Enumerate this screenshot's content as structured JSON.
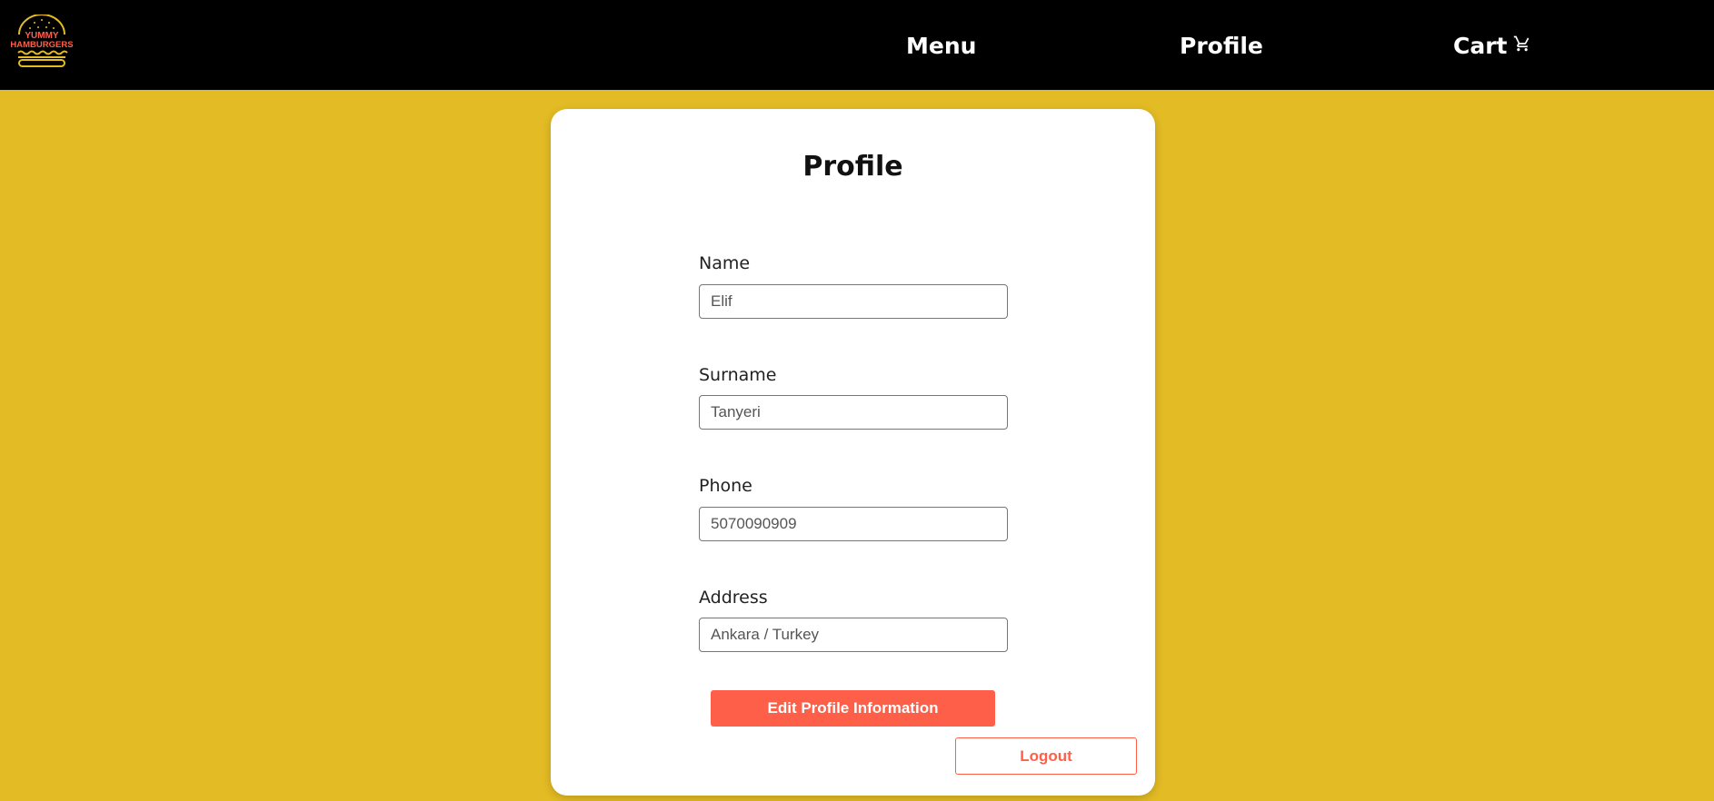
{
  "brand": {
    "logo_line1": "YUMMY",
    "logo_line2": "HAMBURGERS",
    "logo_text_color": "#fe5f49",
    "logo_line_color": "#e3bb24"
  },
  "nav": {
    "menu_label": "Menu",
    "profile_label": "Profile",
    "cart_label": "Cart",
    "cart_icon": "cart-icon"
  },
  "profile": {
    "title": "Profile",
    "fields": {
      "name": {
        "label": "Name",
        "value": "Elif"
      },
      "surname": {
        "label": "Surname",
        "value": "Tanyeri"
      },
      "phone": {
        "label": "Phone",
        "value": "5070090909"
      },
      "address": {
        "label": "Address",
        "value": "Ankara / Turkey"
      }
    },
    "edit_button_label": "Edit Profile Information",
    "logout_button_label": "Logout"
  },
  "colors": {
    "background": "#e3bb24",
    "navbar": "#000000",
    "accent": "#fe5f49",
    "card": "#ffffff"
  }
}
